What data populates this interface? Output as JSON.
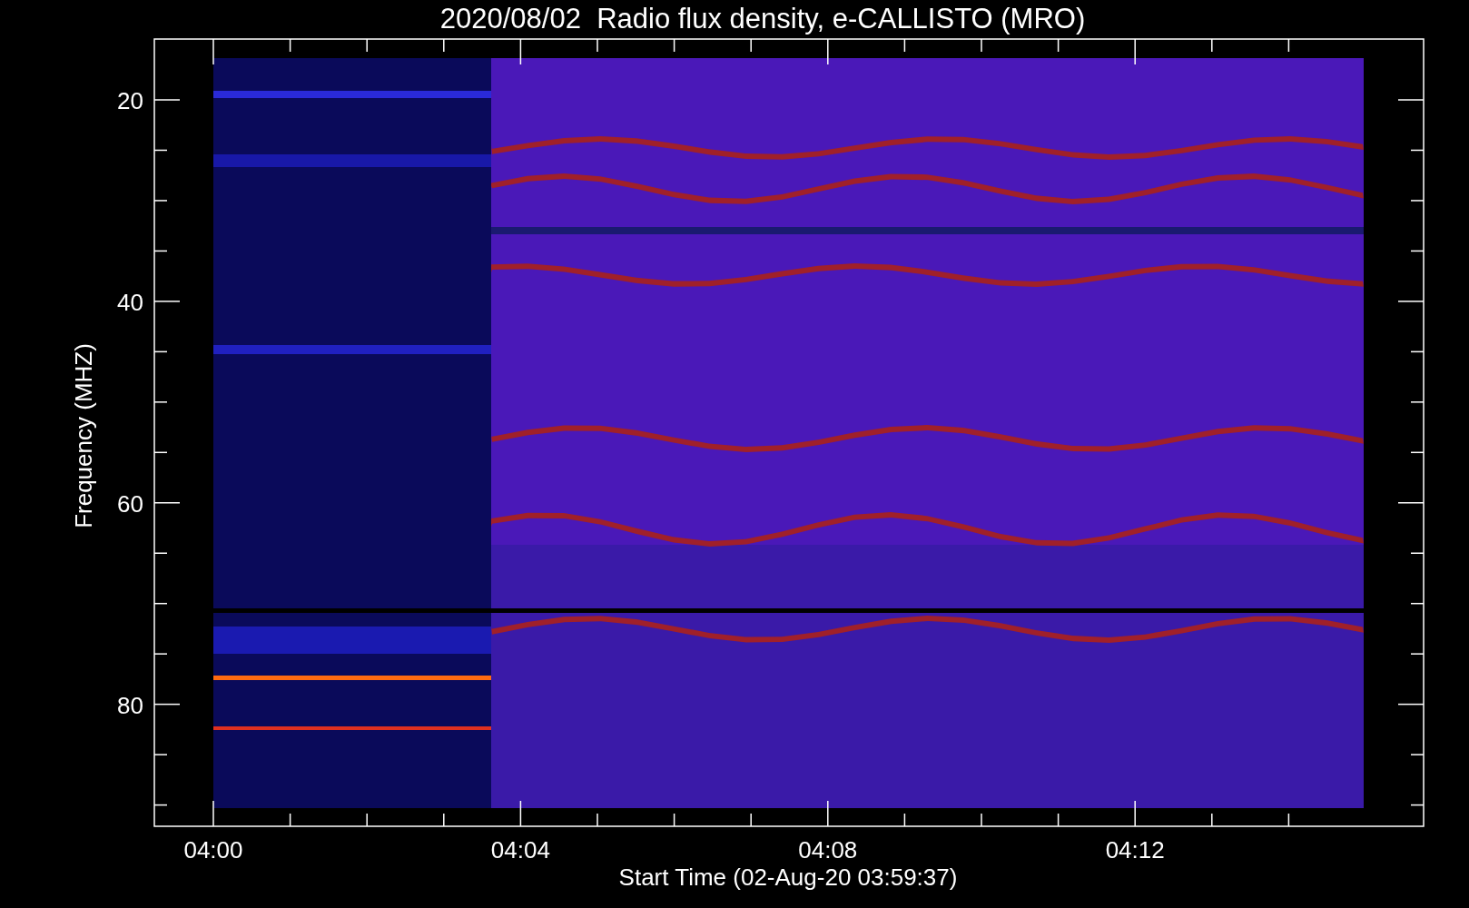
{
  "title": "2020/08/02  Radio flux density, e-CALLISTO (MRO)",
  "y_axis": {
    "label": "Frequency (MHZ)",
    "ticks": [
      "20",
      "40",
      "60",
      "80"
    ]
  },
  "x_axis": {
    "label": "Start Time (02-Aug-20 03:59:37)",
    "ticks": [
      "04:00",
      "04:04",
      "04:08",
      "04:12"
    ]
  }
}
